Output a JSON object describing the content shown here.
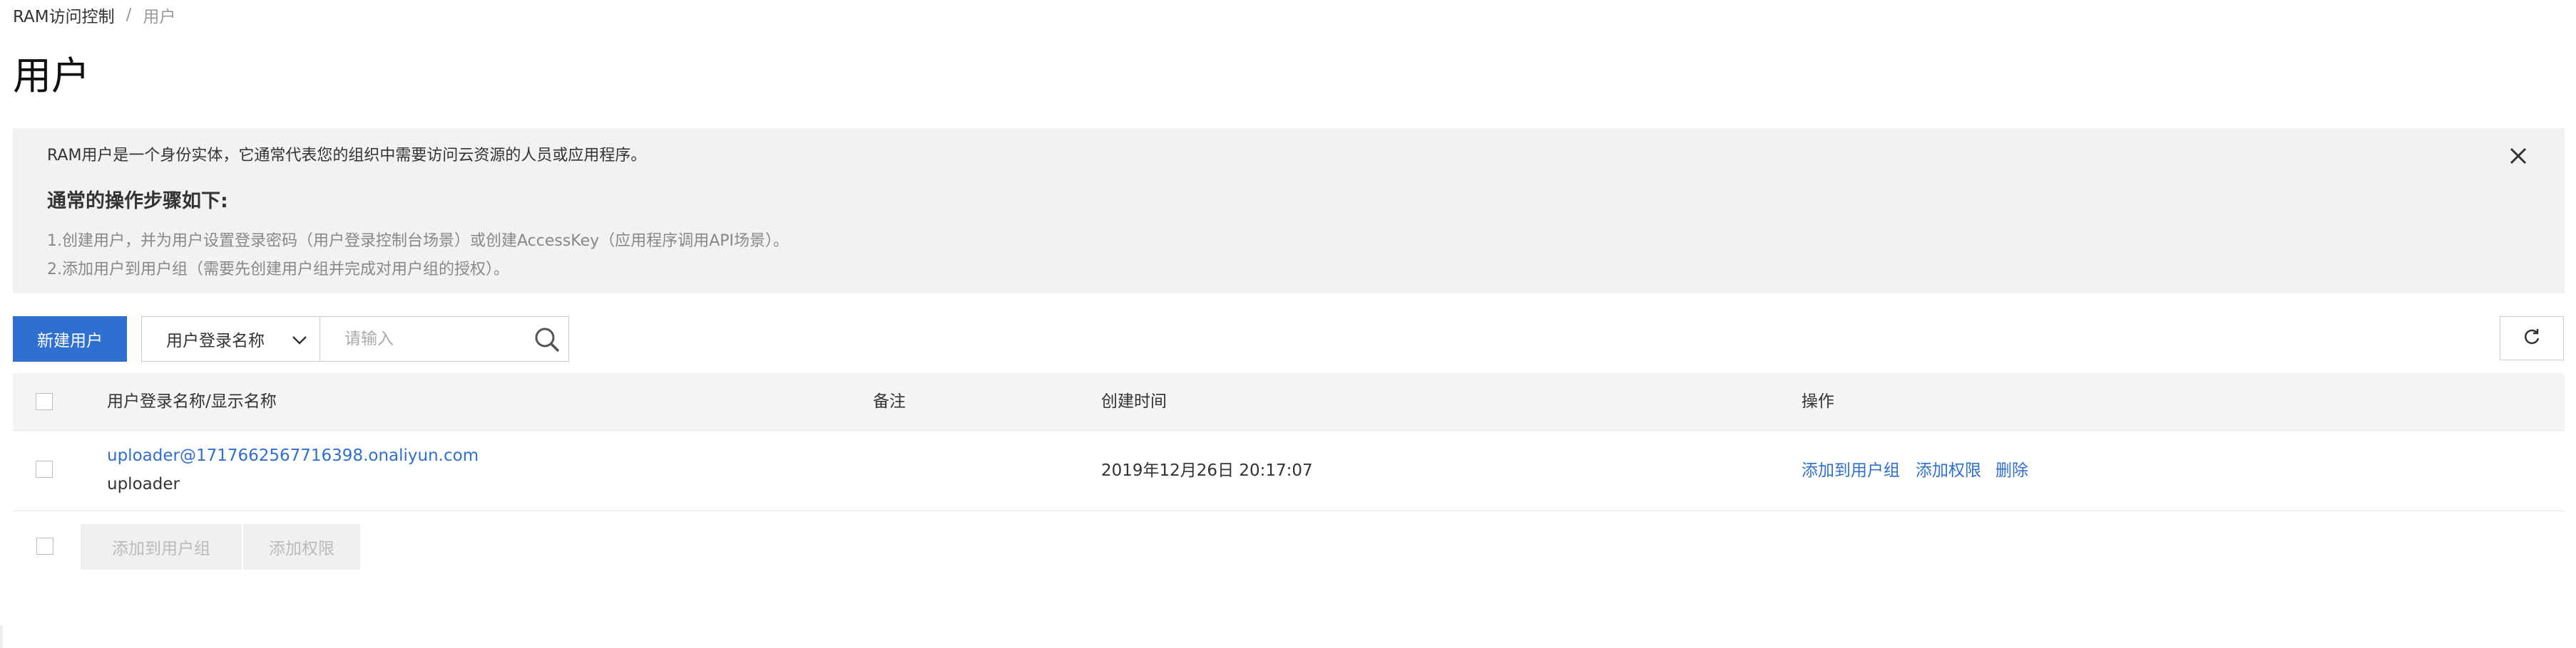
{
  "breadcrumb": {
    "root": "RAM访问控制",
    "separator": "/",
    "current": "用户"
  },
  "page_title": "用户",
  "notice": {
    "description": "RAM用户是一个身份实体，它通常代表您的组织中需要访问云资源的人员或应用程序。",
    "heading": "通常的操作步骤如下:",
    "steps": [
      "1.创建用户，并为用户设置登录密码（用户登录控制台场景）或创建AccessKey（应用程序调用API场景）。",
      "2.添加用户到用户组（需要先创建用户组并完成对用户组的授权）。"
    ],
    "close_icon": "close-icon"
  },
  "toolbar": {
    "create_user_label": "新建用户",
    "search_field_selected": "用户登录名称",
    "search_placeholder": "请输入",
    "search_icon": "search-icon",
    "refresh_icon": "refresh-icon"
  },
  "table": {
    "columns": [
      "用户登录名称/显示名称",
      "备注",
      "创建时间",
      "操作"
    ],
    "rows": [
      {
        "login_name": "uploader@1717662567716398.onaliyun.com",
        "display_name": "uploader",
        "note": "",
        "created_time": "2019年12月26日 20:17:07",
        "actions": [
          "添加到用户组",
          "添加权限",
          "删除"
        ]
      }
    ]
  },
  "batch_actions": {
    "add_to_group_label": "添加到用户组",
    "add_permission_label": "添加权限"
  },
  "colors": {
    "primary": "#2f6fd0",
    "notice_bg": "#f2f2f2",
    "header_bg": "#f5f5f5"
  }
}
